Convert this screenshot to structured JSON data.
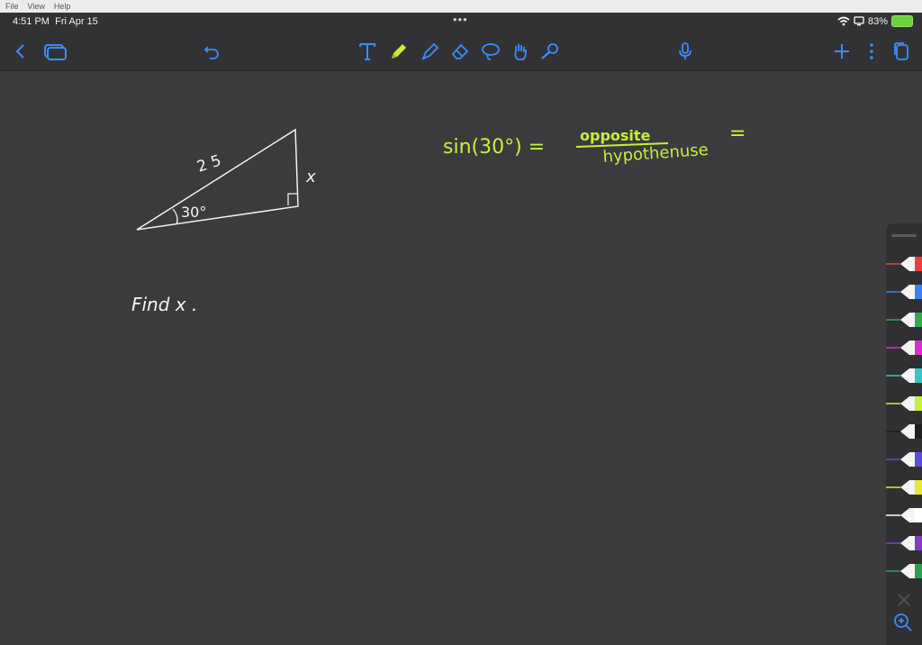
{
  "menu": {
    "file": "File",
    "view": "View",
    "help": "Help"
  },
  "status": {
    "time": "4:51 PM",
    "date": "Fri Apr 15",
    "dots": "•••",
    "battery": "83%"
  },
  "toolbar": {
    "icons": [
      "back-icon",
      "documents-icon",
      "undo-icon",
      "text-icon",
      "pen-icon",
      "highlighter-icon",
      "eraser-icon",
      "lasso-icon",
      "hand-icon",
      "laser-icon",
      "microphone-icon",
      "add-icon",
      "more-icon",
      "pages-icon"
    ]
  },
  "note": {
    "label_hyp": "2 5",
    "label_angle": "30°",
    "label_x": "x",
    "find": "Find   x .",
    "eq_left": "sin(30°) =",
    "eq_num": "opposite",
    "eq_den": "hypothenuse",
    "eq_eq": "="
  },
  "palette": {
    "colors": [
      "#e8413b",
      "#3a82f0",
      "#36a853",
      "#d62fd0",
      "#34c6c4",
      "#c7f03a",
      "#1f1f1f",
      "#5a4ed6",
      "#e7ea30",
      "#ffffff",
      "#7c3fbf",
      "#2f9e4f"
    ]
  }
}
